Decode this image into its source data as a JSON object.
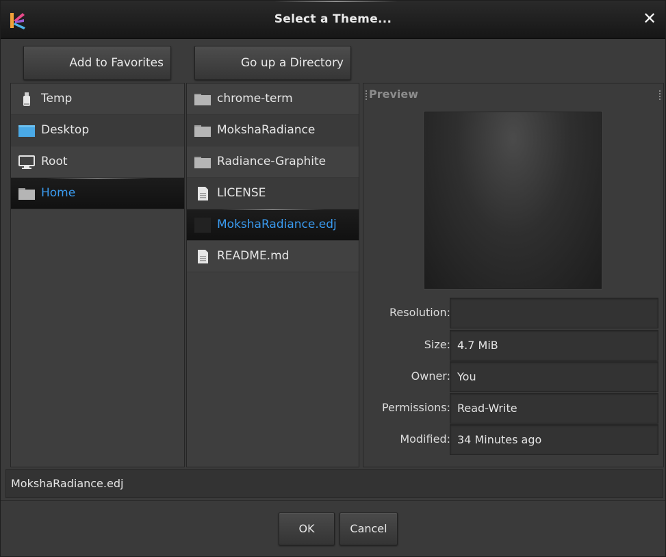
{
  "window": {
    "title": "Select a Theme...",
    "close_glyph": "✕"
  },
  "toolbar": {
    "add_favorites_label": "Add to Favorites",
    "go_up_label": "Go up a Directory"
  },
  "favorites": [
    {
      "label": "Temp",
      "icon": "usb-drive-icon",
      "selected": false
    },
    {
      "label": "Desktop",
      "icon": "desktop-folder-icon",
      "selected": false
    },
    {
      "label": "Root",
      "icon": "monitor-icon",
      "selected": false
    },
    {
      "label": "Home",
      "icon": "folder-icon",
      "selected": true
    }
  ],
  "files": [
    {
      "label": "chrome-term",
      "icon": "folder-icon",
      "selected": false
    },
    {
      "label": "MokshaRadiance",
      "icon": "folder-icon",
      "selected": false
    },
    {
      "label": "Radiance-Graphite",
      "icon": "folder-icon",
      "selected": false
    },
    {
      "label": "LICENSE",
      "icon": "document-icon",
      "selected": false
    },
    {
      "label": "MokshaRadiance.edj",
      "icon": "theme-file-icon",
      "selected": true
    },
    {
      "label": "README.md",
      "icon": "document-icon",
      "selected": false
    }
  ],
  "preview": {
    "title": "Preview",
    "fields": [
      {
        "key": "Resolution:",
        "value": ""
      },
      {
        "key": "Size:",
        "value": "4.7 MiB"
      },
      {
        "key": "Owner:",
        "value": "You"
      },
      {
        "key": "Permissions:",
        "value": "Read-Write"
      },
      {
        "key": "Modified:",
        "value": "34 Minutes ago"
      }
    ]
  },
  "filename": {
    "value": "MokshaRadiance.edj"
  },
  "actions": {
    "ok_label": "OK",
    "cancel_label": "Cancel"
  },
  "colors": {
    "selection_text": "#3a9bf0",
    "desktop_folder": "#4aa9e6"
  }
}
